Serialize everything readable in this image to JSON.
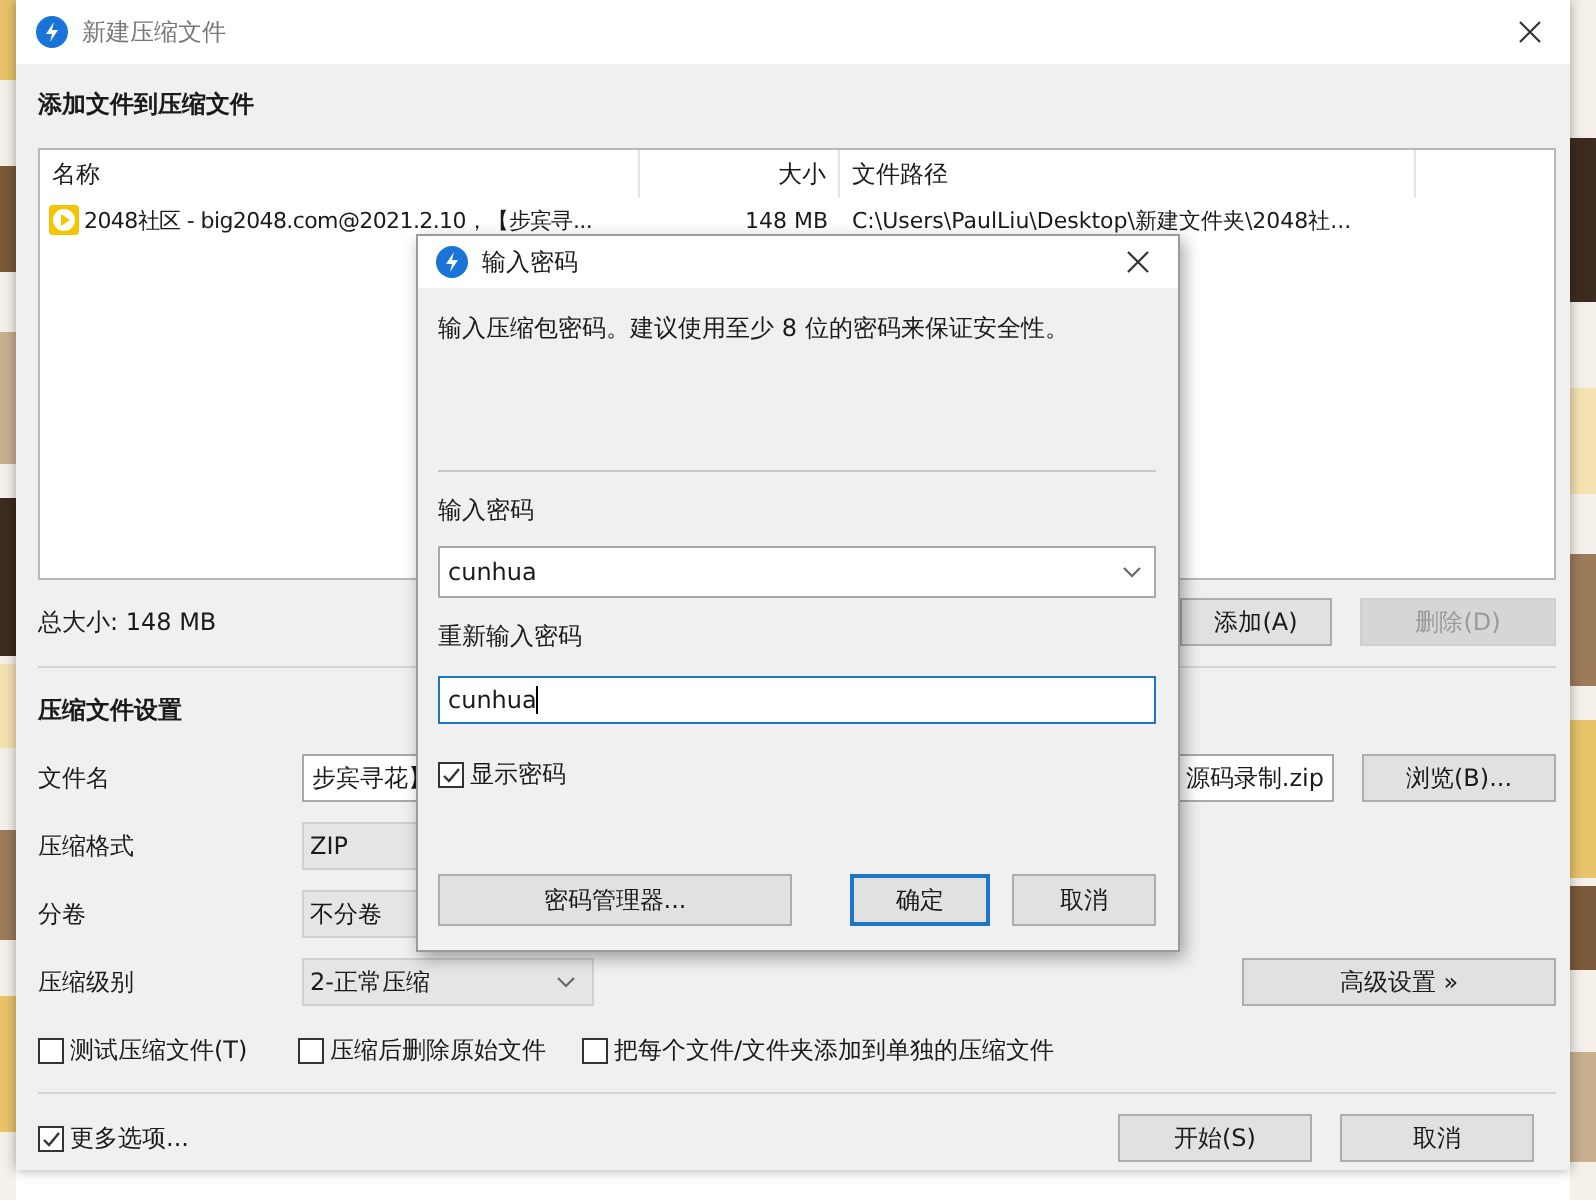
{
  "window": {
    "title": "新建压缩文件"
  },
  "files": {
    "heading": "添加文件到压缩文件",
    "columns": [
      "名称",
      "大小",
      "文件路径"
    ],
    "rows": [
      {
        "name": "2048社区 - big2048.com@2021.2.10，【步宾寻...",
        "size": "148 MB",
        "path": "C:\\Users\\PaulLiu\\Desktop\\新建文件夹\\2048社..."
      }
    ],
    "total": "总大小: 148 MB",
    "buttons": [
      {
        "label": "添加(A)",
        "disabled": false
      },
      {
        "label": "删除(D)",
        "disabled": true
      }
    ]
  },
  "settings": {
    "heading": "压缩文件设置",
    "filename": {
      "label": "文件名",
      "start": "步宾寻花】",
      "end": "源码录制.zip"
    },
    "browse": "浏览(B)...",
    "selects": [
      {
        "label": "压缩格式",
        "value": "ZIP"
      },
      {
        "label": "分卷",
        "value": "不分卷"
      },
      {
        "label": "压缩级别",
        "value": "2-正常压缩"
      }
    ],
    "advanced": "高级设置 »",
    "options": [
      {
        "label": "测试压缩文件(T)",
        "checked": false
      },
      {
        "label": "压缩后删除原始文件",
        "checked": false
      },
      {
        "label": "把每个文件/文件夹添加到单独的压缩文件",
        "checked": false
      }
    ]
  },
  "footer": {
    "more": {
      "label": "更多选项...",
      "checked": true
    },
    "buttons": [
      "开始(S)",
      "取消"
    ]
  },
  "dialog": {
    "title": "输入密码",
    "message": "输入压缩包密码。建议使用至少 8 位的密码来保证安全性。",
    "password": {
      "label": "输入密码",
      "value": "cunhua",
      "focused": false
    },
    "confirm": {
      "label": "重新输入密码",
      "value": "cunhua",
      "focused": true
    },
    "show_password": {
      "label": "显示密码",
      "checked": true
    },
    "buttons": [
      {
        "label": "密码管理器...",
        "default": false
      },
      {
        "label": "确定",
        "default": true
      },
      {
        "label": "取消",
        "default": false
      }
    ]
  }
}
